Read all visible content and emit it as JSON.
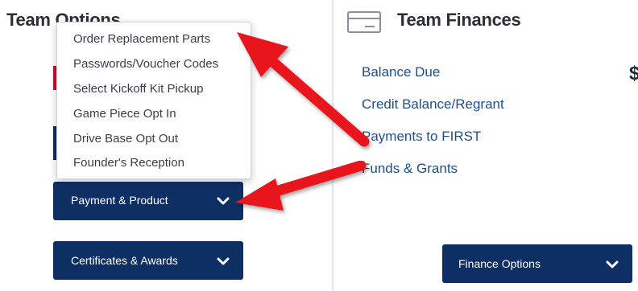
{
  "team_options": {
    "title": "Team Options",
    "menu_items": [
      "Order Replacement Parts",
      "Passwords/Voucher Codes",
      "Select Kickoff Kit Pickup",
      "Game Piece Opt In",
      "Drive Base Opt Out",
      "Founder's Reception"
    ],
    "payment_product_label": "Payment & Product",
    "certificates_awards_label": "Certificates & Awards"
  },
  "team_finances": {
    "title": "Team Finances",
    "links": [
      "Balance Due",
      "Credit Balance/Regrant",
      "Payments to FIRST",
      "Funds & Grants"
    ],
    "balance_symbol": "$",
    "finance_options_label": "Finance Options"
  },
  "colors": {
    "button_navy": "#0d2f63",
    "link_blue": "#1f4f8b",
    "annotation_arrow": "#e8151b"
  },
  "icons": {
    "chevron": "chevron-down-icon",
    "card": "credit-card-icon"
  }
}
